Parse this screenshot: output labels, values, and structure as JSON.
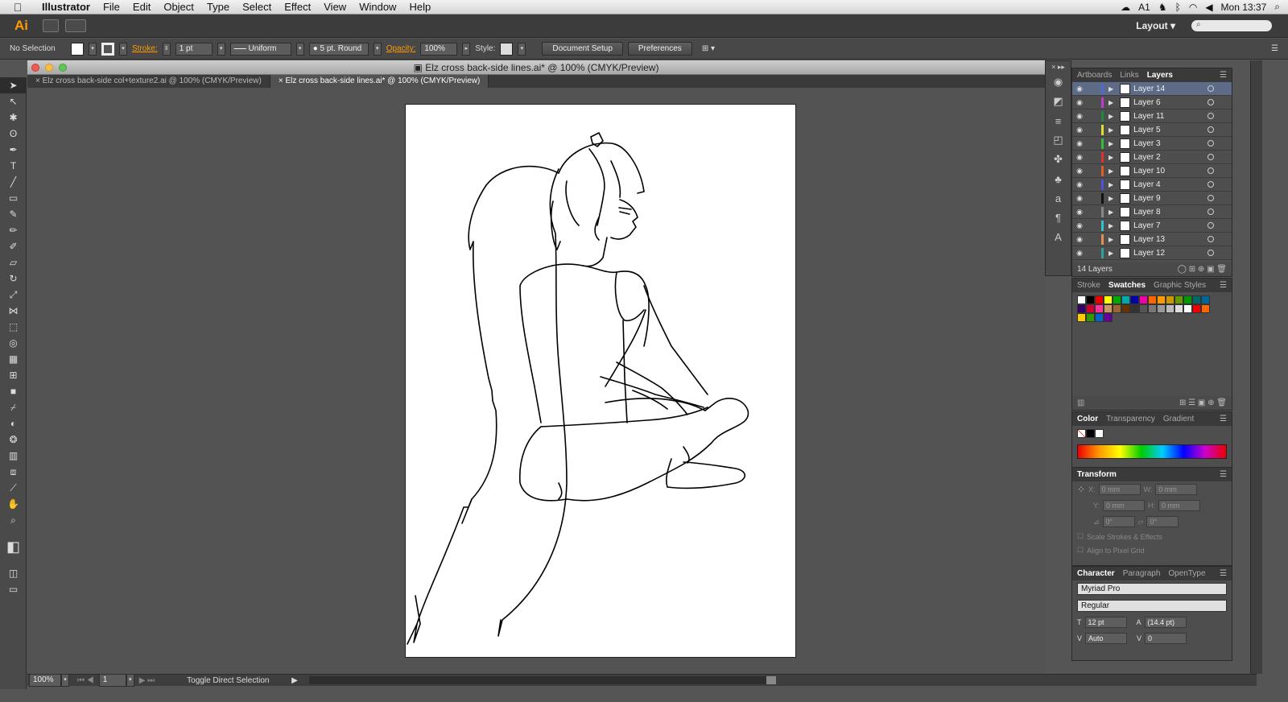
{
  "menubar": {
    "app": "Illustrator",
    "items": [
      "File",
      "Edit",
      "Object",
      "Type",
      "Select",
      "Effect",
      "View",
      "Window",
      "Help"
    ],
    "indicator": "1",
    "clock": "Mon 13:37"
  },
  "appbar": {
    "logo": "Ai",
    "workspace": "Layout",
    "search_placeholder": ""
  },
  "control": {
    "selection": "No Selection",
    "stroke_label": "Stroke:",
    "stroke_weight": "1 pt",
    "profile": "Uniform",
    "brush": "5 pt. Round",
    "opacity_label": "Opacity:",
    "opacity": "100%",
    "style_label": "Style:",
    "doc_setup": "Document Setup",
    "preferences": "Preferences"
  },
  "window": {
    "title": "Elz cross back-side lines.ai* @ 100% (CMYK/Preview)"
  },
  "tabs": [
    {
      "label": "Elz cross back-side col+texture2.ai @ 100% (CMYK/Preview)"
    },
    {
      "label": "Elz cross back-side lines.ai* @ 100% (CMYK/Preview)"
    }
  ],
  "status": {
    "zoom": "100%",
    "artboard": "1",
    "message": "Toggle Direct Selection"
  },
  "layers_panel": {
    "tabs": [
      "Artboards",
      "Links",
      "Layers"
    ],
    "layers": [
      {
        "name": "Layer 14",
        "color": "#4f6bd0"
      },
      {
        "name": "Layer 6",
        "color": "#c03ad0"
      },
      {
        "name": "Layer 11",
        "color": "#1c8a3a"
      },
      {
        "name": "Layer 5",
        "color": "#e0e030"
      },
      {
        "name": "Layer 3",
        "color": "#30c040"
      },
      {
        "name": "Layer 2",
        "color": "#e03030"
      },
      {
        "name": "Layer 10",
        "color": "#e06020"
      },
      {
        "name": "Layer 4",
        "color": "#5050e0"
      },
      {
        "name": "Layer 9",
        "color": "#111111"
      },
      {
        "name": "Layer 8",
        "color": "#888888"
      },
      {
        "name": "Layer 7",
        "color": "#30c0d0"
      },
      {
        "name": "Layer 13",
        "color": "#e09050"
      },
      {
        "name": "Layer 12",
        "color": "#30a0a0"
      }
    ],
    "count": "14 Layers"
  },
  "swatches_panel": {
    "tabs": [
      "Stroke",
      "Swatches",
      "Graphic Styles"
    ]
  },
  "color_panel": {
    "tabs": [
      "Color",
      "Transparency",
      "Gradient"
    ]
  },
  "transform_panel": {
    "title": "Transform",
    "x_label": "X:",
    "y_label": "Y:",
    "w_label": "W:",
    "h_label": "H:",
    "x": "0 mm",
    "y": "0 mm",
    "w": "0 mm",
    "h": "0 mm",
    "angle": "0°",
    "shear": "0°",
    "scale_strokes": "Scale Strokes & Effects",
    "align_pixel": "Align to Pixel Grid"
  },
  "character_panel": {
    "tabs": [
      "Character",
      "Paragraph",
      "OpenType"
    ],
    "font": "Myriad Pro",
    "style": "Regular",
    "size": "12 pt",
    "leading": "(14.4 pt)",
    "kerning": "Auto",
    "tracking": "0"
  }
}
